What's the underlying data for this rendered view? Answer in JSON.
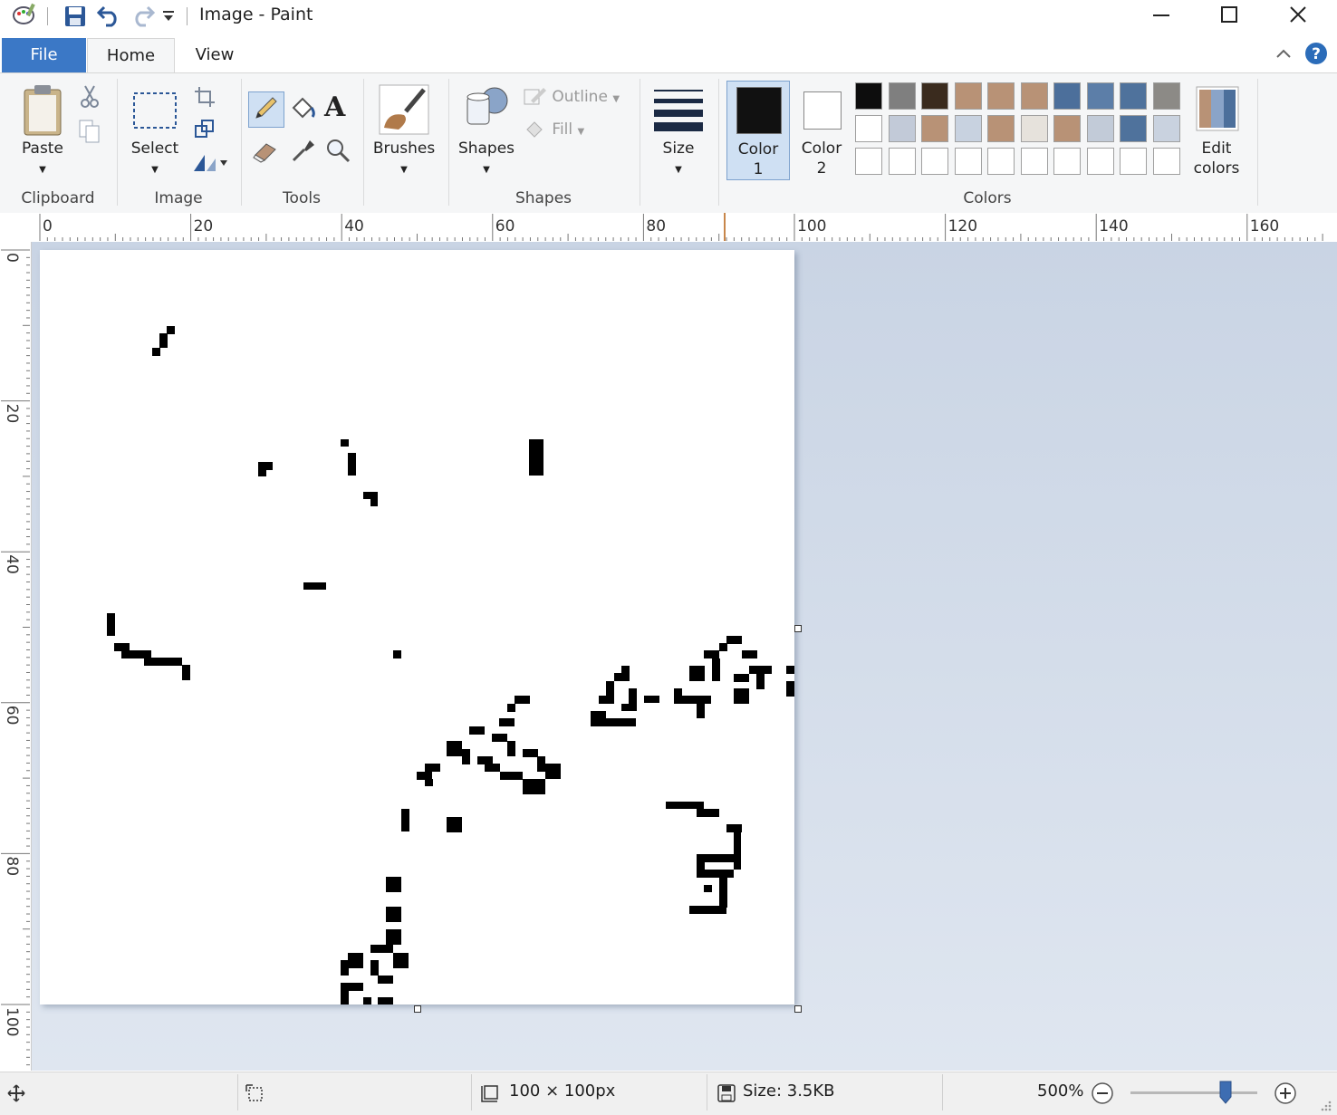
{
  "window": {
    "title": "Image - Paint",
    "minimize_icon": "minimize-icon",
    "maximize_icon": "maximize-icon",
    "close_icon": "close-icon"
  },
  "quick_access": {
    "save_icon": "save-icon",
    "undo_icon": "undo-icon",
    "redo_icon": "redo-icon",
    "customize_icon": "dropdown-icon"
  },
  "tabs": [
    {
      "label": "File"
    },
    {
      "label": "Home"
    },
    {
      "label": "View"
    }
  ],
  "ribbon": {
    "clipboard": {
      "paste": "Paste",
      "group": "Clipboard"
    },
    "image": {
      "select": "Select",
      "group": "Image"
    },
    "tools": {
      "group": "Tools",
      "text_glyph": "A"
    },
    "brushes": {
      "label": "Brushes"
    },
    "shapes": {
      "label": "Shapes",
      "outline": "Outline",
      "fill": "Fill",
      "group": "Shapes"
    },
    "size": {
      "label": "Size"
    },
    "color1": {
      "line1": "Color",
      "line2": "1",
      "color": "#111111"
    },
    "color2": {
      "line1": "Color",
      "line2": "2",
      "color": "#ffffff"
    },
    "colors": {
      "group": "Colors",
      "row1": [
        "#0d0d0d",
        "#7f7f7f",
        "#3a2b1e",
        "#b89276",
        "#b89276",
        "#b89276",
        "#4c6f9b",
        "#5c7ea8",
        "#4f729c",
        "#8c8a86"
      ],
      "row2": [
        "#ffffff",
        "#c2cad8",
        "#b89276",
        "#c8d2e0",
        "#b89276",
        "#e6e2dc",
        "#b89276",
        "#c2cbd8",
        "#4f729c",
        "#c9d2df"
      ],
      "row3": [
        "#ffffff",
        "#ffffff",
        "#ffffff",
        "#ffffff",
        "#ffffff",
        "#ffffff",
        "#ffffff",
        "#ffffff",
        "#ffffff",
        "#ffffff"
      ]
    },
    "edit_colors": {
      "line1": "Edit",
      "line2": "colors"
    }
  },
  "ruler": {
    "h_labels": [
      "0",
      "20",
      "40",
      "60",
      "80",
      "100",
      "120",
      "140",
      "160"
    ],
    "v_labels": [
      "0",
      "20",
      "40",
      "60",
      "80",
      "100"
    ]
  },
  "status": {
    "canvas_size": "100 × 100px",
    "file_size": "Size: 3.5KB",
    "zoom": "500%",
    "zoom_level_fraction": 0.75
  }
}
